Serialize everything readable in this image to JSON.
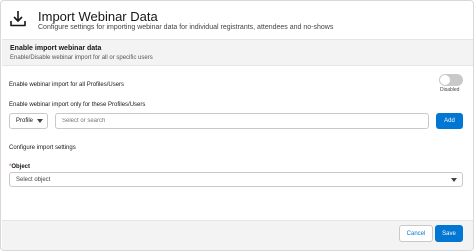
{
  "header": {
    "icon": "download-icon",
    "title": "Import Webinar Data",
    "subtitle": "Configure settings for importing webinar data for individual registrants, attendees and no-shows"
  },
  "section": {
    "title": "Enable import webinar data",
    "description": "Enable/Disable webinar import for all or specific users"
  },
  "import_all": {
    "label": "Enable webinar import for all Profiles/Users",
    "toggle_state": "Disabled",
    "enabled": false
  },
  "import_specific": {
    "label": "Enable webinar import only for these Profiles/Users",
    "select_value": "Profile",
    "search_placeholder": "Select or search",
    "add_label": "Add"
  },
  "import_settings": {
    "label": "Configure import settings",
    "required_marker": "*",
    "object_label": "Object",
    "object_placeholder": "Select object"
  },
  "footer": {
    "cancel_label": "Cancel",
    "save_label": "Save"
  },
  "colors": {
    "brand": "#0176d3",
    "required": "#c23934",
    "toggle_off": "#c9c9c9"
  }
}
